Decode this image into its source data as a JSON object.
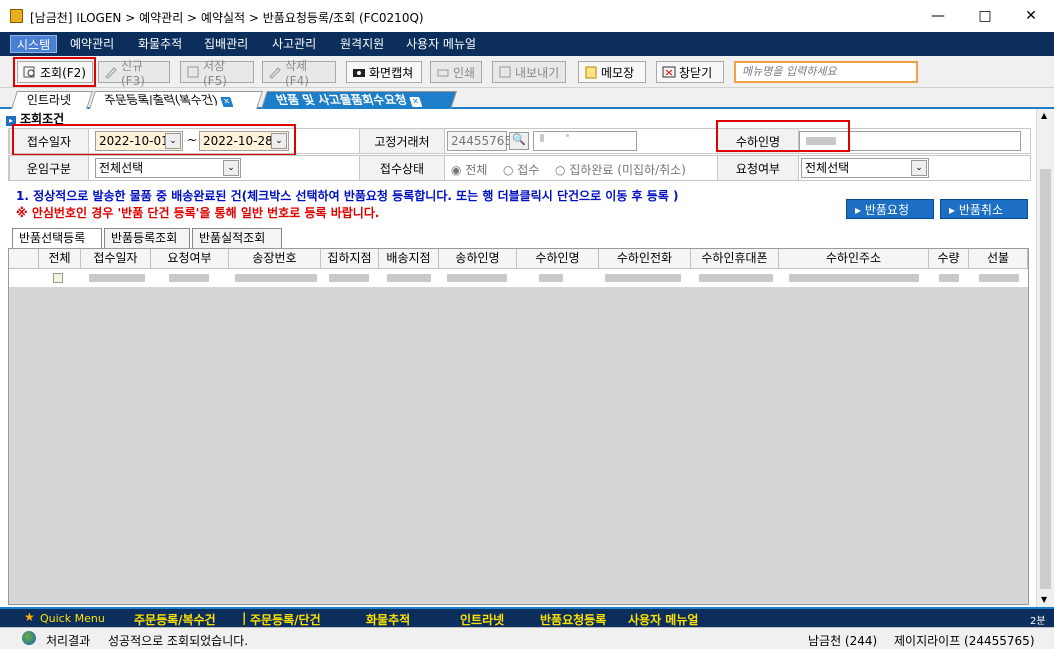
{
  "window": {
    "title": "[남금천] ILOGEN > 예약관리 > 예약실적 > 반품요청등록/조회 (FC0210Q)"
  },
  "menu": [
    "시스템",
    "예약관리",
    "화물추적",
    "집배관리",
    "사고관리",
    "원격지원",
    "사용자 메뉴얼"
  ],
  "toolbar": {
    "search": "조회(F2)",
    "new": "신규(F3)",
    "save": "저장(F5)",
    "delete": "삭제(F4)",
    "capture": "화면캡쳐",
    "print": "인쇄",
    "export": "내보내기",
    "memo": "메모장",
    "close": "창닫기",
    "menu_search_placeholder": "메뉴명을 입력하세요"
  },
  "tabs": [
    {
      "label": "인트라넷"
    },
    {
      "label": "주문등록/출력(복수건)"
    },
    {
      "label": "반품 및 사고물품회수요청"
    }
  ],
  "section": {
    "title": "조회조건"
  },
  "form": {
    "receipt_date_label": "접수일자",
    "date_from": "2022-10-01",
    "tilde": "~",
    "date_to": "2022-10-28",
    "fixed_client_label": "고정거래처",
    "fixed_client_value": "24455765",
    "recipient_name_label": "수하인명",
    "fare_type_label": "운임구분",
    "fare_type_value": "전체선택",
    "receipt_status_label": "접수상태",
    "status_options": [
      "전체",
      "접수",
      "집하완료 (미집하/취소)"
    ],
    "request_label": "요청여부",
    "request_value": "전체선택"
  },
  "notices": {
    "line1": "1. 정상적으로 발송한 물품 중 배송완료된 건(체크박스 선택하여 반품요청 등록합니다. 또는 행 더블클릭시 단건으로 이동 후 등록 )",
    "line2": "※ 안심번호인 경우 '반품 단건 등록'을 통해 일반 번호로 등록 바랍니다."
  },
  "actions": {
    "return_request": "반품요청",
    "return_cancel": "반품취소"
  },
  "subtabs": [
    "반품선택등록",
    "반품등록조회",
    "반품실적조회"
  ],
  "grid": {
    "columns": [
      "전체",
      "접수일자",
      "요청여부",
      "송장번호",
      "집하지점",
      "배송지점",
      "송하인명",
      "수하인명",
      "수하인전화",
      "수하인휴대폰",
      "수하인주소",
      "수량",
      "선불"
    ]
  },
  "quick_menu": {
    "label": "Quick Menu",
    "items": [
      "주문등록/복수건",
      "주문등록/단건",
      "화물추적",
      "인트라넷",
      "반품요청등록",
      "사용자 메뉴얼"
    ],
    "page": "2분"
  },
  "status": {
    "result_label": "처리결과",
    "result_text": "성공적으로 조회되었습니다.",
    "branch": "남금천 (244)",
    "company": "제이지라이프 (24455765)"
  }
}
